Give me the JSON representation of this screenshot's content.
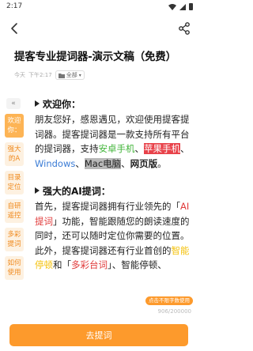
{
  "status": {
    "time": "2:17"
  },
  "document": {
    "title": "提客专业提词器-演示文稿（免费）",
    "date": "今天",
    "time": "下午2:17",
    "folder": "全部"
  },
  "sidebar": {
    "collapse_label": "«",
    "items": [
      {
        "label": "欢迎你：",
        "active": true
      },
      {
        "label": "强大的A",
        "active": false
      },
      {
        "label": "目录定位",
        "active": false
      },
      {
        "label": "自研遥控",
        "active": false
      },
      {
        "label": "多彩提词",
        "active": false
      },
      {
        "label": "如何使用",
        "active": false
      }
    ]
  },
  "content": {
    "section1": {
      "heading": "欢迎你：",
      "p1": "朋友您好，感恩遇见，欢迎使用提客提词器。提客提词器是一款支持所有平台的提词器，支持",
      "android": "安卓手机",
      "sep1": "、",
      "apple": "苹果手机",
      "sep2": "、",
      "windows": "Windows",
      "sep3": "、",
      "mac": "Mac电脑",
      "sep4": "、",
      "web": "网页版",
      "end": "。"
    },
    "section2": {
      "heading": "强大的AI提词：",
      "p1": "首先，提客提词器拥有行业领先的「",
      "ai": "AI提词",
      "p2": "」功能，智能跟随您的朗读速度的同时，还可以随时定位你需要的位置。",
      "p3": "此外，提客提词器还有行业首创的",
      "smart": "智能停顿",
      "p4": "和「",
      "colorful": "多彩台词",
      "p5": "」、智能停顿、"
    }
  },
  "footer": {
    "badge": "点击不限字数使用",
    "count": "906/200000",
    "button": "去提词"
  }
}
